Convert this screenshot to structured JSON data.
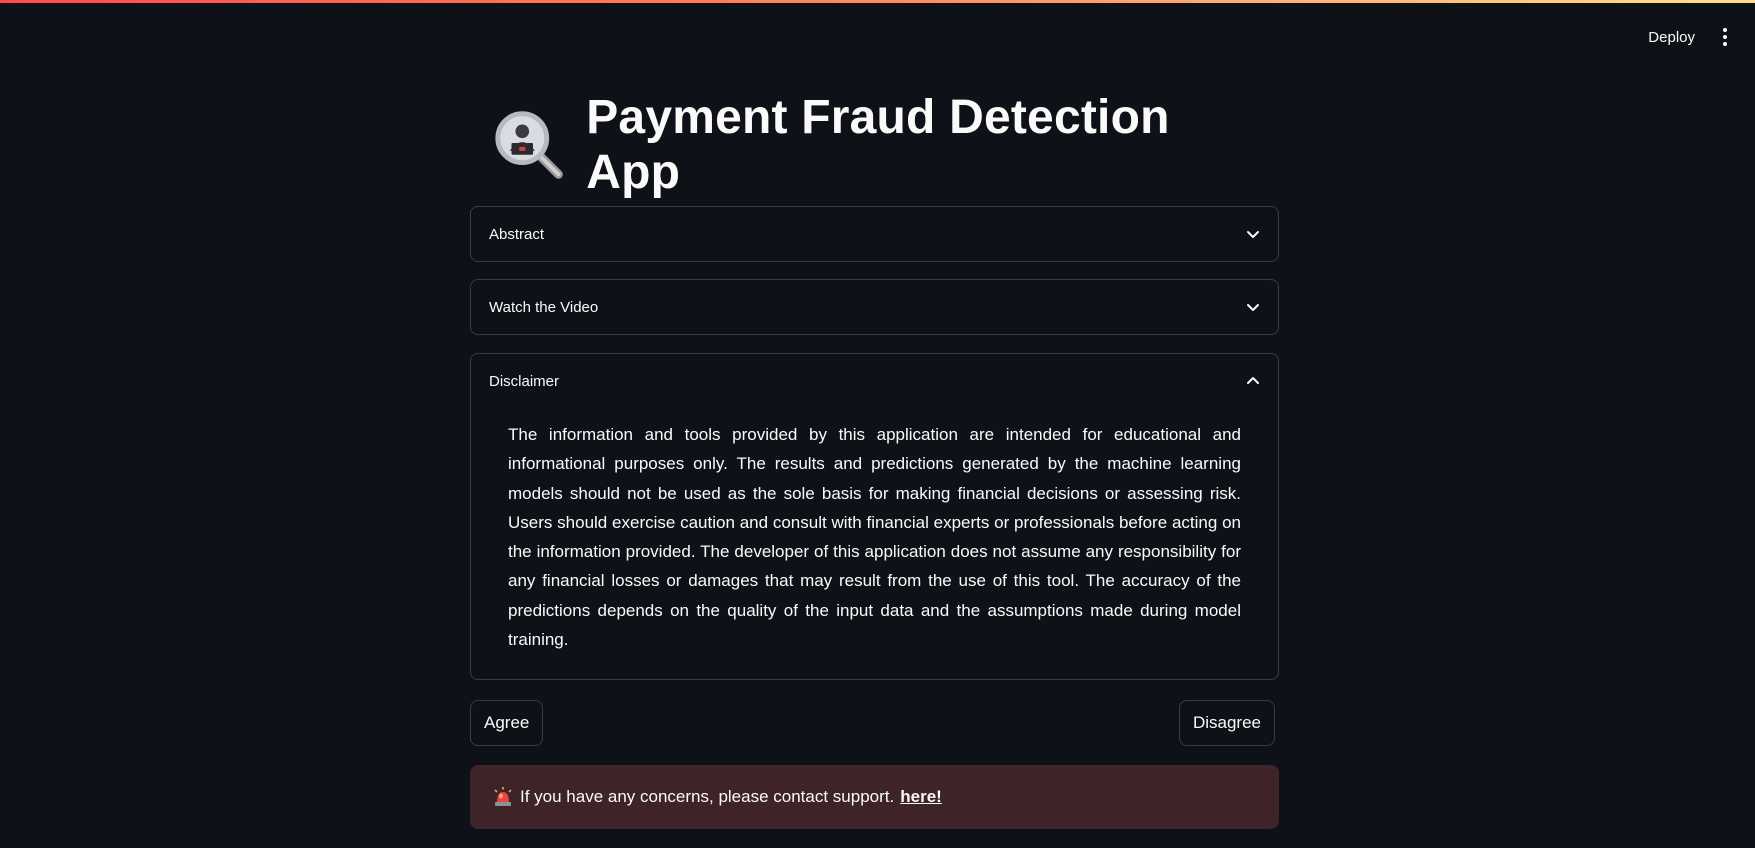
{
  "header": {
    "deploy_label": "Deploy",
    "menu_icon": "more-vertical-icon"
  },
  "app": {
    "title": "Payment Fraud Detection App",
    "title_icon": "magnifier-hacker-icon"
  },
  "expanders": [
    {
      "label": "Abstract",
      "expanded": false
    },
    {
      "label": "Watch the Video",
      "expanded": false
    },
    {
      "label": "Disclaimer",
      "expanded": true,
      "body": "The information and tools provided by this application are intended for educational and informational purposes only. The results and predictions generated by the machine learning models should not be used as the sole basis for making financial decisions or assessing risk. Users should exercise caution and consult with financial experts or professionals before acting on the information provided. The developer of this application does not assume any responsibility for any financial losses or damages that may result from the use of this tool. The accuracy of the predictions depends on the quality of the input data and the assumptions made during model training."
    }
  ],
  "buttons": {
    "agree": "Agree",
    "disagree": "Disagree"
  },
  "alert": {
    "icon": "rotating-light-icon",
    "text": "If you have any concerns, please contact support.",
    "link": "here!",
    "bg_color": "#3e2328"
  },
  "colors": {
    "background": "#0e1117",
    "border": "#3a3d45",
    "text": "#fafafa"
  }
}
